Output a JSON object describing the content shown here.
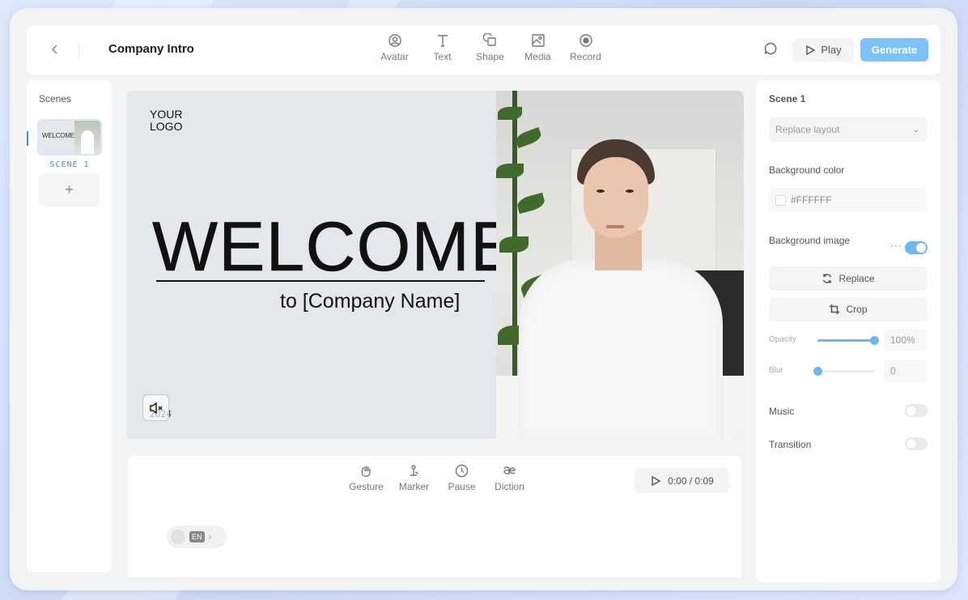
{
  "header": {
    "title": "Company Intro",
    "tools": [
      {
        "label": "Avatar",
        "icon": "avatar-icon"
      },
      {
        "label": "Text",
        "icon": "text-icon"
      },
      {
        "label": "Shape",
        "icon": "shape-icon"
      },
      {
        "label": "Media",
        "icon": "media-icon"
      },
      {
        "label": "Record",
        "icon": "record-icon"
      }
    ],
    "play_label": "Play",
    "generate_label": "Generate",
    "accent_color": "#7cc2f7"
  },
  "scenes": {
    "title": "Scenes",
    "items": [
      {
        "label": "SCENE 1",
        "thumb_text": "WELCOME"
      }
    ],
    "add_label": "+"
  },
  "canvas": {
    "logo_text_line1": "YOUR",
    "logo_text_line2": "LOGO",
    "headline": "WELCOME",
    "subtitle": "to [Company Name]",
    "year": "2024"
  },
  "timeline": {
    "tools": [
      {
        "label": "Gesture",
        "icon": "gesture-icon"
      },
      {
        "label": "Marker",
        "icon": "marker-icon"
      },
      {
        "label": "Pause",
        "icon": "clock-icon"
      },
      {
        "label": "Diction",
        "icon": "diction-icon"
      }
    ],
    "time": "0:00 / 0:09",
    "language": "EN"
  },
  "properties": {
    "scene_title": "Scene 1",
    "layout_placeholder": "Replace layout",
    "background_color_label": "Background color",
    "background_color_value": "#FFFFFF",
    "background_image_label": "Background image",
    "background_image_enabled": true,
    "replace_label": "Replace",
    "crop_label": "Crop",
    "opacity_label": "Opacity",
    "opacity_value": "100%",
    "opacity_fraction": 1.0,
    "blur_label": "Blur",
    "blur_value": "0",
    "blur_fraction": 0.0,
    "music_label": "Music",
    "music_enabled": false,
    "transition_label": "Transition",
    "transition_enabled": false
  }
}
